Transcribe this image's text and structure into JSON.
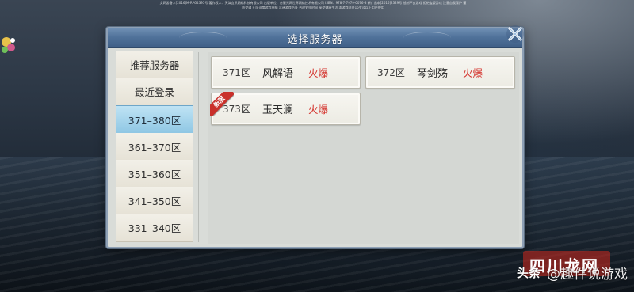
{
  "copyright_text": "文网游备字[2016]M-RPG4395号 著作权人：天津宜讯网络科技有限公司 出版单位：合肥光网世界网络技术有限公司 ISBN：978-7-7979-0076-8 新广出审[2016]2329号 抵制不良游戏 拒绝盗版游戏 注意自我保护 谨防受骗上当 适度游戏益脑 沉迷游戏伤身 合理安排时间 享受健康生活 本游戏适合16岁及以上用户使用",
  "dialog": {
    "title": "选择服务器"
  },
  "sidebar": {
    "items": [
      {
        "label": "推荐服务器",
        "active": false
      },
      {
        "label": "最近登录",
        "active": false
      },
      {
        "label": "371–380区",
        "active": true
      },
      {
        "label": "361–370区",
        "active": false
      },
      {
        "label": "351–360区",
        "active": false
      },
      {
        "label": "341–350区",
        "active": false
      },
      {
        "label": "331–340区",
        "active": false
      }
    ]
  },
  "servers": [
    {
      "zone": "371区",
      "name": "风解语",
      "status": "火爆",
      "is_new": false
    },
    {
      "zone": "372区",
      "name": "琴剑殇",
      "status": "火爆",
      "is_new": false
    },
    {
      "zone": "373区",
      "name": "玉天澜",
      "status": "火爆",
      "is_new": true
    }
  ],
  "new_tag_label": "新服",
  "watermark": {
    "brand": "头条",
    "text": "@趣件说游戏",
    "stamp": "四川龙网"
  },
  "colors": {
    "header_blue": "#50729a",
    "active_tab": "#8fc7e4",
    "status_red": "#d4322c",
    "new_tag_red": "#c9302a"
  }
}
